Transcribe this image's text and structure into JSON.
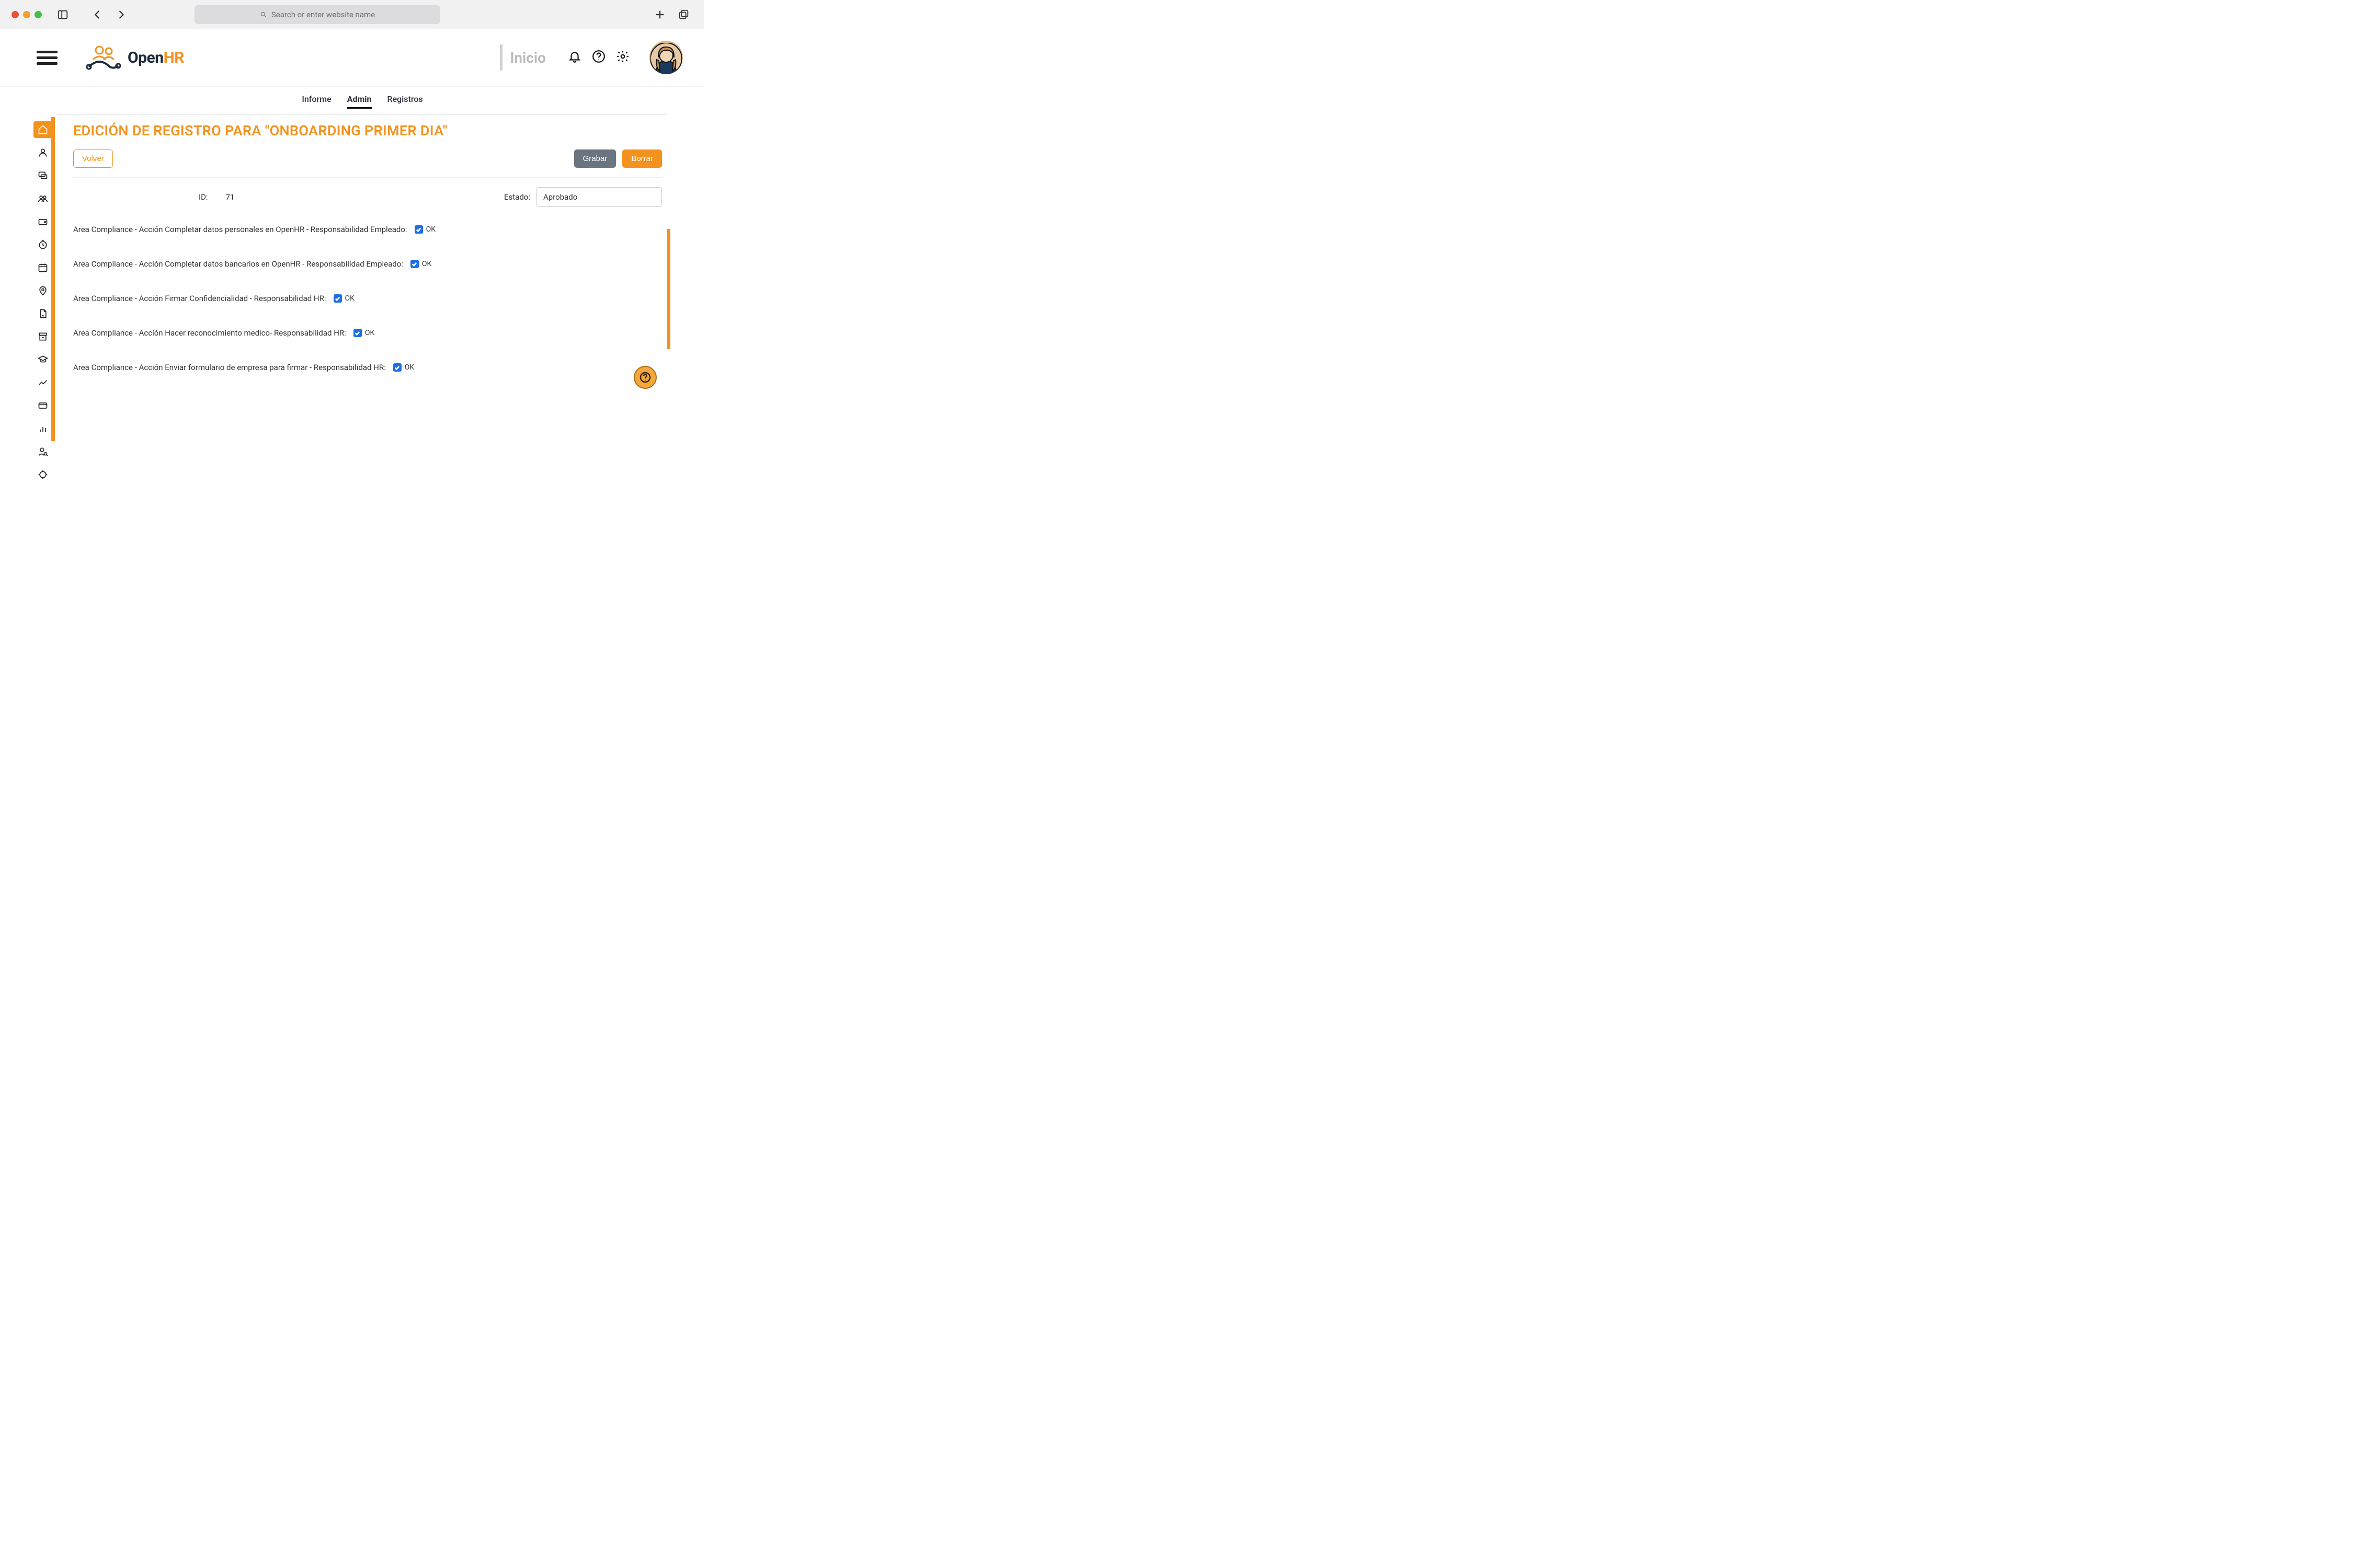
{
  "browser": {
    "url_placeholder": "Search or enter website name"
  },
  "header": {
    "brand_open": "Open",
    "brand_hr": "HR",
    "page_label": "Inicio"
  },
  "subnav": {
    "informe": "Informe",
    "admin": "Admin",
    "registros": "Registros"
  },
  "page": {
    "title": "EDICIÓN DE REGISTRO PARA \"ONBOARDING PRIMER DIA\"",
    "volver_label": "Volver",
    "grabar_label": "Grabar",
    "borrar_label": "Borrar",
    "id_label": "ID:",
    "id_value": "71",
    "estado_label": "Estado:",
    "estado_value": "Aprobado",
    "ok_label": "OK",
    "tasks": [
      {
        "label": "Area Compliance - Acción Completar datos personales en OpenHR - Responsabilidad Empleado:",
        "checked": true
      },
      {
        "label": "Area Compliance - Acción Completar datos bancarios en OpenHR - Responsabilidad Empleado:",
        "checked": true
      },
      {
        "label": "Area Compliance - Acción Firmar Confidencialidad - Responsabilidad HR:",
        "checked": true
      },
      {
        "label": "Area Compliance - Acción Hacer reconocimiento medico- Responsabilidad HR:",
        "checked": true
      },
      {
        "label": "Area Compliance - Acción Enviar formulario de empresa para firmar - Responsabilidad HR:",
        "checked": true
      }
    ]
  },
  "colors": {
    "accent": "#f3921e",
    "check": "#1d6fe3"
  }
}
